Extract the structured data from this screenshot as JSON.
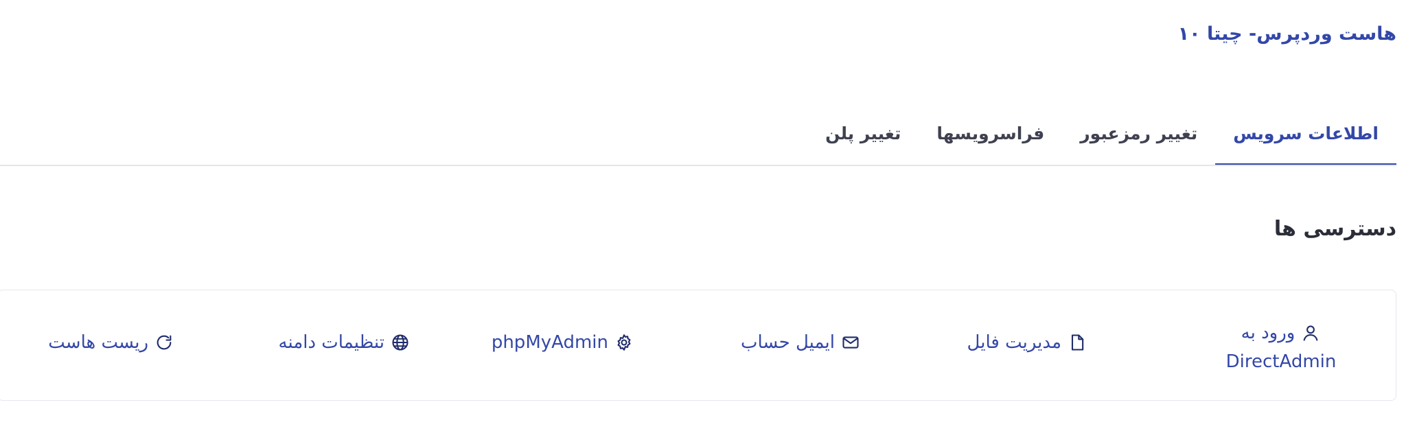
{
  "page": {
    "title": "هاست وردپرس- چیتا ۱۰"
  },
  "tabs": [
    {
      "label": "اطلاعات سرویس",
      "active": true
    },
    {
      "label": "تغییر رمزعبور",
      "active": false
    },
    {
      "label": "فراسرویسها",
      "active": false
    },
    {
      "label": "تغییر پلن",
      "active": false
    }
  ],
  "section": {
    "heading": "دسترسی ها"
  },
  "actions": {
    "directadmin": {
      "line1": "ورود به",
      "line2": "DirectAdmin",
      "icon": "user-icon"
    },
    "file_manager": {
      "label": "مدیریت فایل",
      "icon": "file-icon"
    },
    "email": {
      "label": "ایمیل حساب",
      "icon": "mail-icon"
    },
    "phpmyadmin": {
      "label": "phpMyAdmin",
      "icon": "gear-icon"
    },
    "domain_settings": {
      "label": "تنظیمات دامنه",
      "icon": "globe-icon"
    },
    "reset_host": {
      "label": "ریست هاست",
      "icon": "refresh-icon"
    }
  },
  "colors": {
    "accent": "#3347a8",
    "link": "#1f2b6a",
    "text": "#2a2d3a",
    "border": "#e3e5ea"
  }
}
